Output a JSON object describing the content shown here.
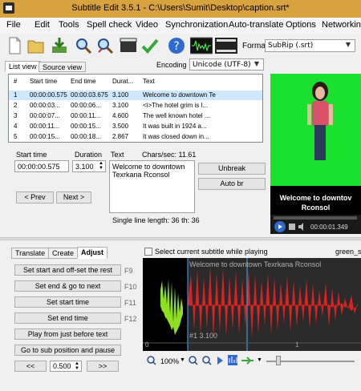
{
  "window": {
    "title": "Subtitle Edit 3.5.1 - C:\\Users\\Sumit\\Desktop\\caption.srt*"
  },
  "menu": [
    "File",
    "Edit",
    "Tools",
    "Spell check",
    "Video",
    "Synchronization",
    "Auto-translate",
    "Options",
    "Networking"
  ],
  "toolbar": {
    "icons": [
      "new-file-icon",
      "open-folder-icon",
      "save-download-icon",
      "find-icon",
      "replace-icon",
      "visual-sync-icon",
      "spell-check-icon",
      "help-icon",
      "waveform-toggle-icon",
      "video-toggle-icon"
    ],
    "format_label": "Format",
    "format_value": "SubRip (.srt)"
  },
  "tabs": {
    "list_view": "List view",
    "source_view": "Source view"
  },
  "encoding": {
    "label": "Encoding",
    "value": "Unicode (UTF-8)"
  },
  "subtitle_list": {
    "columns": [
      "#",
      "Start time",
      "End time",
      "Durat...",
      "Text"
    ],
    "rows": [
      {
        "num": "1",
        "start": "00:00:00.575",
        "end": "00:00:03.675",
        "dur": "3.100",
        "text": "Welcome to downtown Te",
        "selected": true
      },
      {
        "num": "2",
        "start": "00:00:03...",
        "end": "00:00:06...",
        "dur": "3.100",
        "text": "<i>The hotel grim is l...",
        "selected": false
      },
      {
        "num": "3",
        "start": "00:00:07...",
        "end": "00:00:11...",
        "dur": "4.600",
        "text": "The well known hotel ...",
        "selected": false
      },
      {
        "num": "4",
        "start": "00:00:11...",
        "end": "00:00:15...",
        "dur": "3.500",
        "text": "It was built in 1924 a...",
        "selected": false
      },
      {
        "num": "5",
        "start": "00:00:15...",
        "end": "00:00:18...",
        "dur": "2.867",
        "text": "It was closed down in...",
        "selected": false
      }
    ]
  },
  "editor": {
    "start_time_label": "Start time",
    "start_time": "00:00:00.575",
    "duration_label": "Duration",
    "duration": "3.100",
    "text_label": "Text",
    "chars_sec": "Chars/sec: 11.61",
    "text_line1": "Welcome to downtown",
    "text_line2": "Texrkana Rconsol",
    "unbreak": "Unbreak",
    "auto_br": "Auto br",
    "prev": "< Prev",
    "next": "Next >",
    "single_line": "Single line length: 36  th: 36"
  },
  "video": {
    "caption_line1": "Welcome to downtov",
    "caption_line2": "Rconsol",
    "time": "00:00:01.349"
  },
  "lower_tabs": {
    "translate": "Translate",
    "create": "Create",
    "adjust": "Adjust"
  },
  "adjust_buttons": [
    {
      "label": "Set start and off-set the rest",
      "key": "F9"
    },
    {
      "label": "Set end & go to next",
      "key": "F10"
    },
    {
      "label": "Set start time",
      "key": "F11"
    },
    {
      "label": "Set end time",
      "key": "F12"
    },
    {
      "label": "Play from just before text",
      "key": ""
    },
    {
      "label": "Go to sub position and pause",
      "key": ""
    }
  ],
  "seek": {
    "back": "<<",
    "value": "0.500",
    "forward": ">>"
  },
  "waveform": {
    "select_current_label": "Select current subtitle while playing",
    "green_label": "green_s",
    "overlay_text": "Welcome to downtown Texrkana Rconsol",
    "bottom_text": "#1  3.100",
    "tick_0": "0",
    "tick_1": "1",
    "zoom": "100%"
  },
  "colors": {
    "titlebar": "#d8a23e",
    "selection": "#cde8ff",
    "green_screen": "#19e12d",
    "wave_red": "#e02020",
    "wave_green": "#8fe020"
  }
}
